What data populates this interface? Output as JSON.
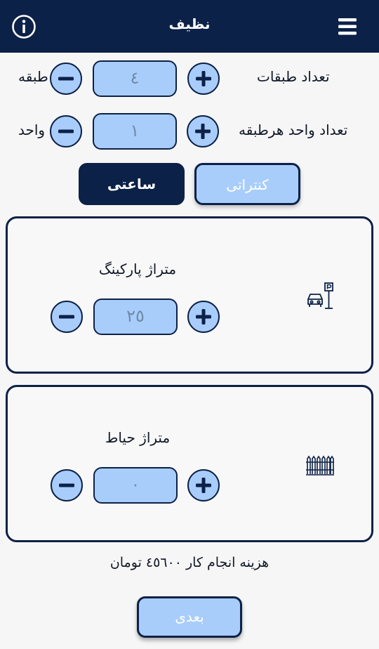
{
  "appbar": {
    "title": "نظیف",
    "info_icon": "info-circle-icon",
    "menu_icon": "hamburger-menu-icon"
  },
  "floors": {
    "label": "تعداد طبقات",
    "unit": "طبقه",
    "value": "٤"
  },
  "units": {
    "label": "تعداد واحد هرطبقه",
    "unit": "واحد",
    "value": "١"
  },
  "contract_types": {
    "hourly": "ساعتی",
    "contract": "کنتراتی",
    "selected": "hourly"
  },
  "parking": {
    "title": "متراژ پارکینگ",
    "value": "٢٥",
    "icon": "parking-car-icon"
  },
  "yard": {
    "title": "متراژ حیاط",
    "value": "٠",
    "icon": "fence-icon"
  },
  "cost_text": "هزینه انجام کار ٤٥٦٠٠ تومان",
  "next_label": "بعدی",
  "colors": {
    "navy": "#0c2147",
    "light_blue": "#a9cdfb",
    "background": "#f6f6f6"
  }
}
